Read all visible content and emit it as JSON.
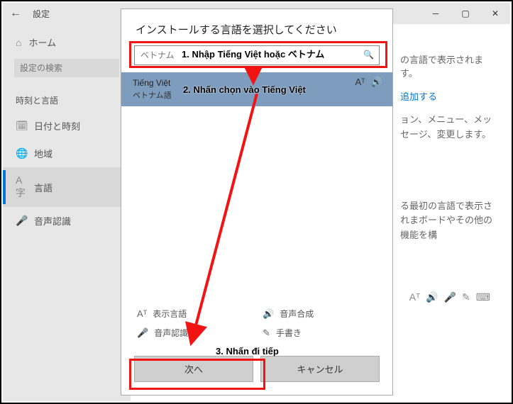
{
  "window": {
    "title": "設定",
    "back_label": "←"
  },
  "sidebar": {
    "home": "ホーム",
    "search_placeholder": "設定の検索",
    "section": "時刻と言語",
    "items": [
      {
        "label": "日付と時刻"
      },
      {
        "label": "地域"
      },
      {
        "label": "言語"
      },
      {
        "label": "音声認識"
      }
    ]
  },
  "main": {
    "line1_suffix": "の言語で表示されます。",
    "add_link": "追加する",
    "line2": "ョン、メニュー、メッセージ、変更します。",
    "line3": "る最初の言語で表示されまボードやその他の機能を構"
  },
  "dialog": {
    "title": "インストールする言語を選択してください",
    "search_placeholder": "ベトナム",
    "result": {
      "native": "Tiếng Việt",
      "local": "ベトナム語"
    },
    "caps": {
      "display": "表示言語",
      "tts": "音声合成",
      "speech": "音声認識",
      "handwriting": "手書き"
    },
    "next": "次へ",
    "cancel": "キャンセル"
  },
  "annotations": {
    "step1": "1. Nhập Tiếng Việt hoặc ベトナム",
    "step2": "2. Nhấn chọn vào Tiếng Việt",
    "step3": "3. Nhấn đi tiếp"
  }
}
